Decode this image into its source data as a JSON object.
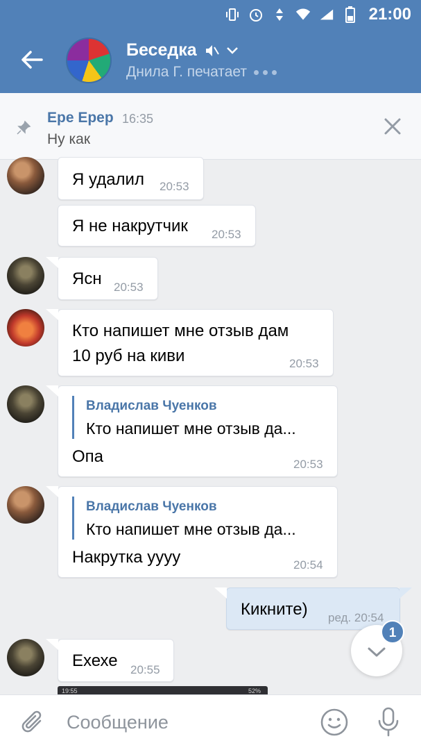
{
  "status_bar": {
    "time": "21:00"
  },
  "header": {
    "title": "Беседка",
    "typing": "Днила Г. печатает"
  },
  "pinned": {
    "author": "Ере Ерер",
    "time": "16:35",
    "text": "Ну как"
  },
  "messages": [
    {
      "text": "Я удалил",
      "time": "20:53"
    },
    {
      "text": "Я не накрутчик",
      "time": "20:53"
    },
    {
      "text": "Ясн",
      "time": "20:53"
    },
    {
      "text": "Кто напишет мне отзыв дам\n10 руб на киви",
      "line1": "Кто напишет мне отзыв дам",
      "line2": "10 руб на киви",
      "time": "20:53"
    },
    {
      "reply_author": "Владислав Чуенков",
      "reply_text": "Кто напишет мне отзыв да...",
      "text": "Опа",
      "time": "20:53"
    },
    {
      "reply_author": "Владислав Чуенков",
      "reply_text": "Кто напишет мне отзыв да...",
      "text": "Накрутка уууу",
      "time": "20:54"
    },
    {
      "text": "Кикните)",
      "time": "ред. 20:54"
    },
    {
      "text": "Ехехе",
      "time": "20:55"
    }
  ],
  "scroll_badge": "1",
  "preview_status": "19:55",
  "preview_battery": "52%",
  "composer": {
    "placeholder": "Сообщение"
  },
  "colors": {
    "header": "#5181b8",
    "background": "#edeef0",
    "outgoing_bubble": "#dce8f5",
    "link": "#4a76a8"
  },
  "icons": [
    "back-arrow-icon",
    "mute-icon",
    "chevron-down-icon",
    "pin-icon",
    "close-icon",
    "chevron-down-icon",
    "attach-icon",
    "smile-icon",
    "mic-icon"
  ]
}
